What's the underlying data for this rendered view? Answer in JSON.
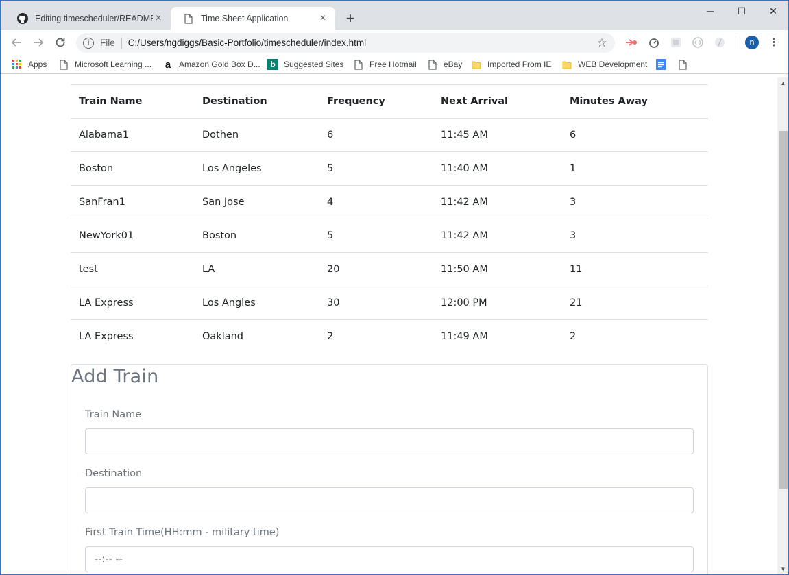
{
  "browser": {
    "tabs": [
      {
        "title": "Editing timescheduler/README.m",
        "icon": "github-icon",
        "active": false
      },
      {
        "title": "Time Sheet Application",
        "icon": "page-icon",
        "active": true
      }
    ],
    "new_tab": "+",
    "window_controls": {
      "minimize": "─",
      "maximize": "☐",
      "close": "✕"
    },
    "address": {
      "scheme": "File",
      "url": "C:/Users/ngdiggs/Basic-Portfolio/timescheduler/index.html"
    },
    "profile_initial": "n",
    "bookmarks": [
      {
        "label": "Apps",
        "icon": "apps-grid-icon"
      },
      {
        "label": "Microsoft Learning ...",
        "icon": "page-icon"
      },
      {
        "label": "Amazon Gold Box D...",
        "icon": "amazon-icon"
      },
      {
        "label": "Suggested Sites",
        "icon": "bing-icon"
      },
      {
        "label": "Free Hotmail",
        "icon": "page-icon"
      },
      {
        "label": "eBay",
        "icon": "page-icon"
      },
      {
        "label": "Imported From IE",
        "icon": "folder-icon"
      },
      {
        "label": "WEB Development",
        "icon": "folder-icon"
      },
      {
        "label": "",
        "icon": "google-docs-icon"
      },
      {
        "label": "",
        "icon": "page-icon"
      }
    ]
  },
  "schedule": {
    "headers": [
      "Train Name",
      "Destination",
      "Frequency",
      "Next Arrival",
      "Minutes Away"
    ],
    "rows": [
      [
        "Alabama1",
        "Dothen",
        "6",
        "11:45 AM",
        "6"
      ],
      [
        "Boston",
        "Los Angeles",
        "5",
        "11:40 AM",
        "1"
      ],
      [
        "SanFran1",
        "San Jose",
        "4",
        "11:42 AM",
        "3"
      ],
      [
        "NewYork01",
        "Boston",
        "5",
        "11:42 AM",
        "3"
      ],
      [
        "test",
        "LA",
        "20",
        "11:50 AM",
        "11"
      ],
      [
        "LA Express",
        "Los Angles",
        "30",
        "12:00 PM",
        "21"
      ],
      [
        "LA Express",
        "Oakland",
        "2",
        "11:49 AM",
        "2"
      ]
    ]
  },
  "form": {
    "title": "Add Train",
    "fields": [
      {
        "label": "Train Name",
        "value": ""
      },
      {
        "label": "Destination",
        "value": ""
      },
      {
        "label": "First Train Time(HH:mm - military time)",
        "value": "--:-- --"
      }
    ]
  }
}
